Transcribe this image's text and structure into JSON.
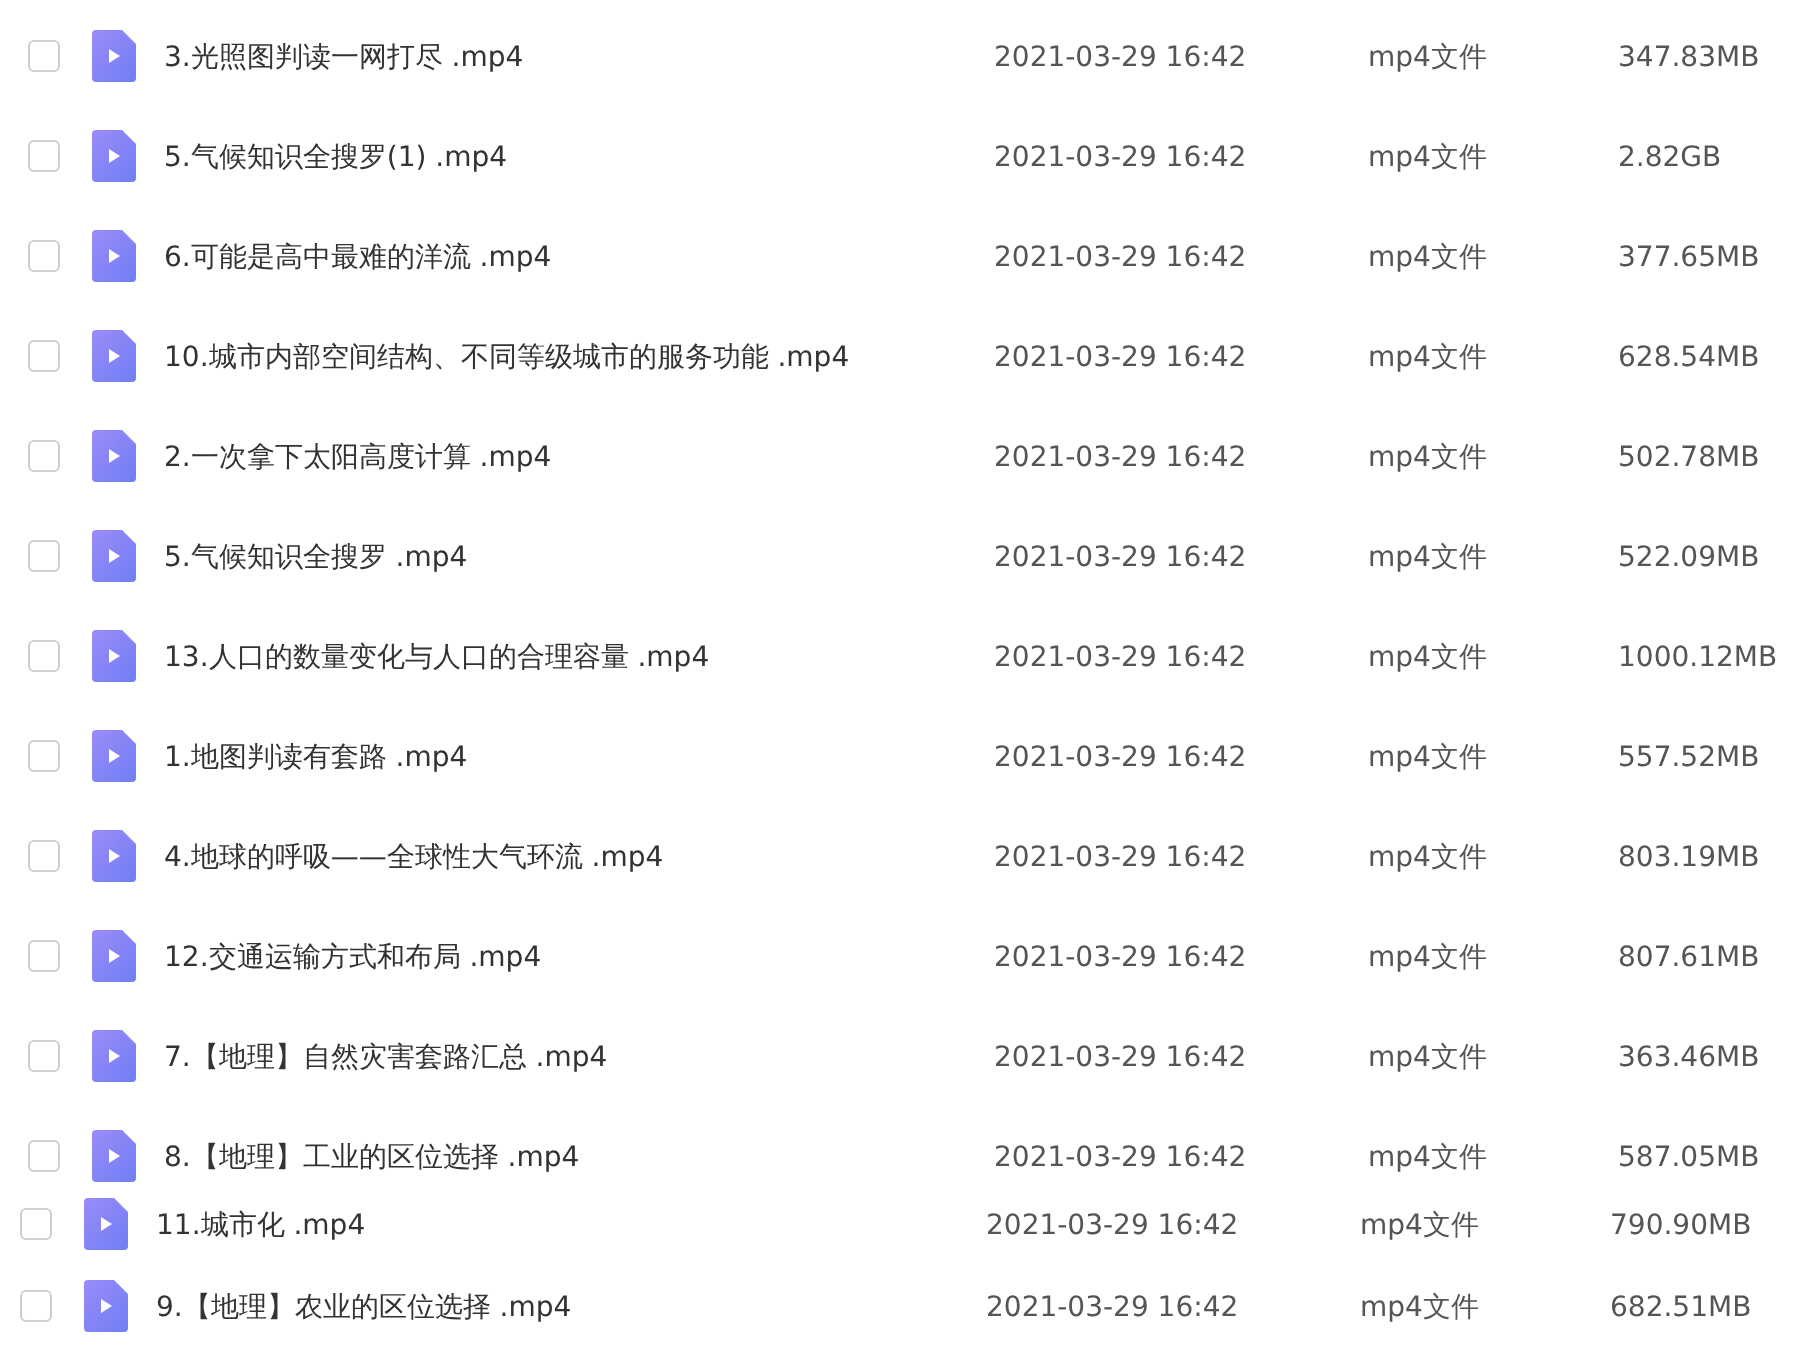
{
  "file_lists": [
    {
      "files": [
        {
          "name": "3.光照图判读一网打尽 .mp4",
          "date": "2021-03-29 16:42",
          "type": "mp4文件",
          "size": "347.83MB",
          "checked": false
        },
        {
          "name": "5.气候知识全搜罗(1) .mp4",
          "date": "2021-03-29 16:42",
          "type": "mp4文件",
          "size": "2.82GB",
          "checked": false
        },
        {
          "name": "6.可能是高中最难的洋流 .mp4",
          "date": "2021-03-29 16:42",
          "type": "mp4文件",
          "size": "377.65MB",
          "checked": false
        },
        {
          "name": "10.城市内部空间结构、不同等级城市的服务功能 .mp4",
          "date": "2021-03-29 16:42",
          "type": "mp4文件",
          "size": "628.54MB",
          "checked": false
        },
        {
          "name": "2.一次拿下太阳高度计算 .mp4",
          "date": "2021-03-29 16:42",
          "type": "mp4文件",
          "size": "502.78MB",
          "checked": false
        },
        {
          "name": "5.气候知识全搜罗 .mp4",
          "date": "2021-03-29 16:42",
          "type": "mp4文件",
          "size": "522.09MB",
          "checked": false
        },
        {
          "name": "13.人口的数量变化与人口的合理容量 .mp4",
          "date": "2021-03-29 16:42",
          "type": "mp4文件",
          "size": "1000.12MB",
          "checked": false
        },
        {
          "name": "1.地图判读有套路 .mp4",
          "date": "2021-03-29 16:42",
          "type": "mp4文件",
          "size": "557.52MB",
          "checked": false
        },
        {
          "name": "4.地球的呼吸——全球性大气环流 .mp4",
          "date": "2021-03-29 16:42",
          "type": "mp4文件",
          "size": "803.19MB",
          "checked": false
        },
        {
          "name": "12.交通运输方式和布局 .mp4",
          "date": "2021-03-29 16:42",
          "type": "mp4文件",
          "size": "807.61MB",
          "checked": false
        },
        {
          "name": "7.【地理】自然灾害套路汇总 .mp4",
          "date": "2021-03-29 16:42",
          "type": "mp4文件",
          "size": "363.46MB",
          "checked": false
        },
        {
          "name": "8.【地理】工业的区位选择 .mp4",
          "date": "2021-03-29 16:42",
          "type": "mp4文件",
          "size": "587.05MB",
          "checked": false
        }
      ]
    },
    {
      "files": [
        {
          "name": "11.城市化 .mp4",
          "date": "2021-03-29 16:42",
          "type": "mp4文件",
          "size": "790.90MB",
          "checked": false
        },
        {
          "name": "9.【地理】农业的区位选择 .mp4",
          "date": "2021-03-29 16:42",
          "type": "mp4文件",
          "size": "682.51MB",
          "checked": false
        }
      ]
    }
  ]
}
